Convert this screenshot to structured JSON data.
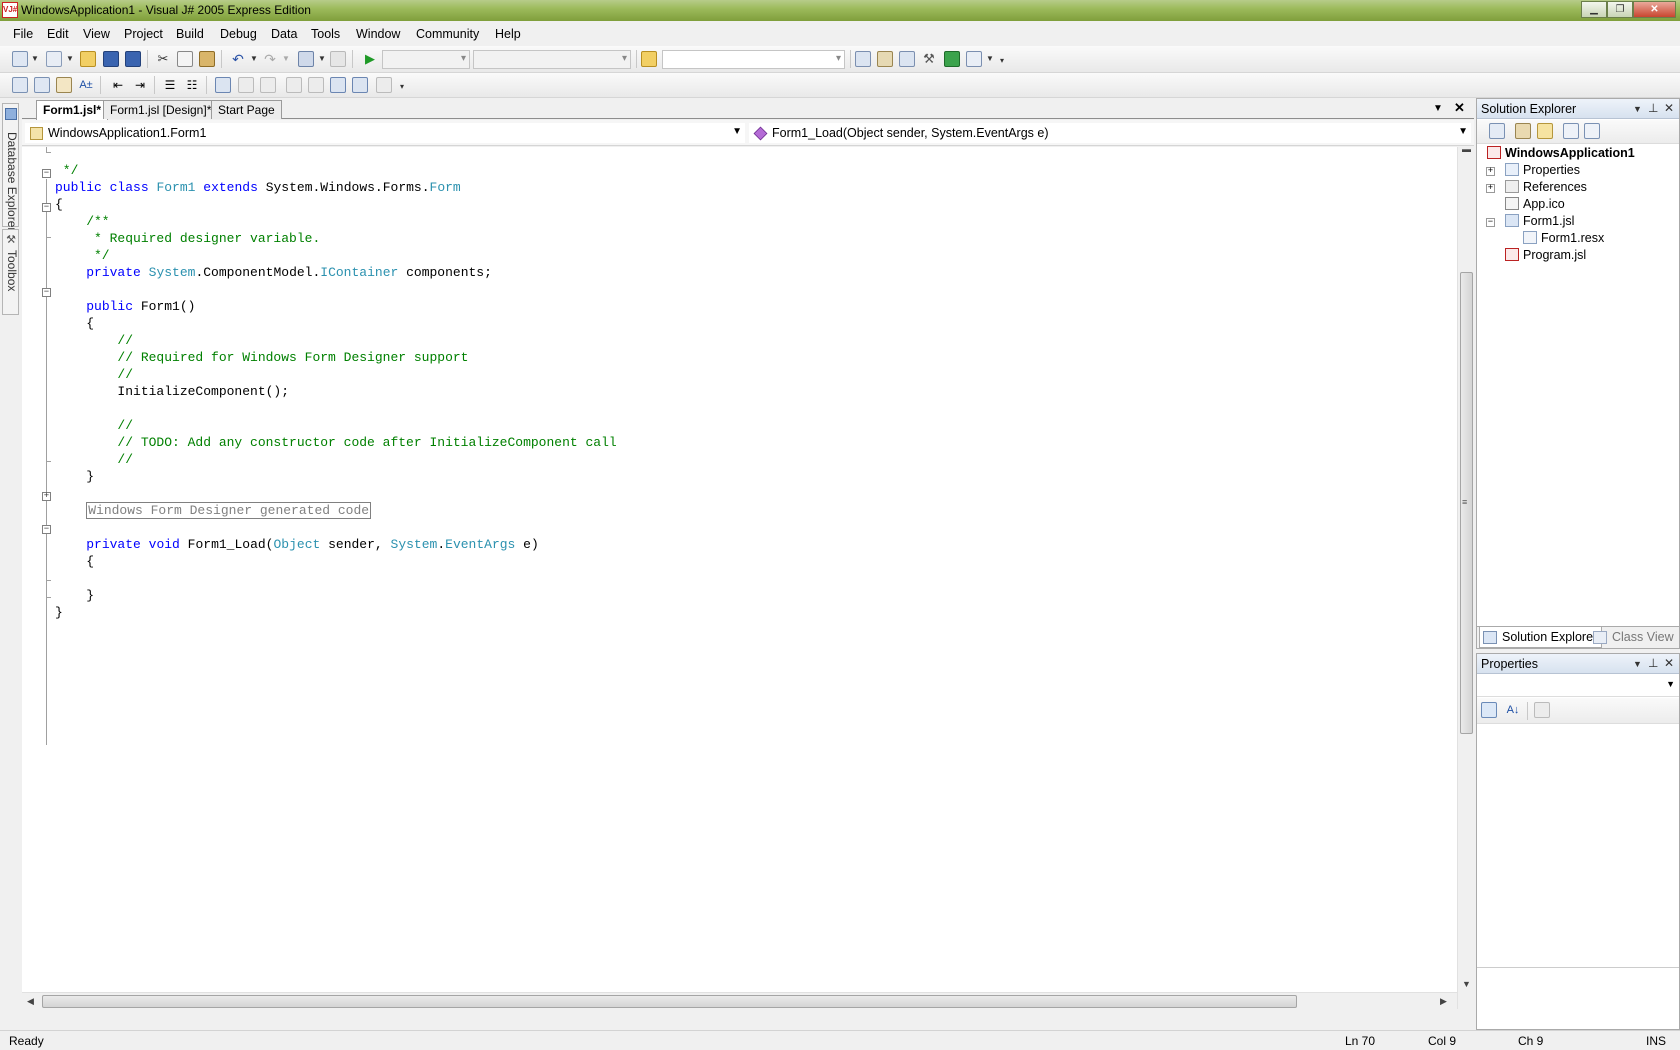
{
  "window": {
    "title": "WindowsApplication1 - Visual J# 2005 Express Edition",
    "icon_text": "VJ#"
  },
  "menu": [
    "File",
    "Edit",
    "View",
    "Project",
    "Build",
    "Debug",
    "Data",
    "Tools",
    "Window",
    "Community",
    "Help"
  ],
  "side_tabs": {
    "database_explorer": "Database Explorer",
    "toolbox": "Toolbox"
  },
  "doc_tabs": [
    "Form1.jsl*",
    "Form1.jsl [Design]*",
    "Start Page"
  ],
  "nav": {
    "class_combo": "WindowsApplication1.Form1",
    "member_combo": "Form1_Load(Object sender, System.EventArgs e)"
  },
  "code": {
    "l0": " */",
    "l1_kw1": "public",
    "l1_kw2": "class",
    "l1_type": "Form1",
    "l1_kw3": "extends",
    "l1_plain": "System.Windows.Forms.",
    "l1_type2": "Form",
    "l2": "{",
    "l3": "    /**",
    "l4": "     * Required designer variable.",
    "l5": "     */",
    "l6_kw": "private",
    "l6_ns": "System",
    "l6_mid": ".ComponentModel.",
    "l6_type": "IContainer",
    "l6_end": " components;",
    "l7": "",
    "l8_kw": "public",
    "l8_end": " Form1()",
    "l9": "    {",
    "l10": "        //",
    "l11": "        // Required for Windows Form Designer support",
    "l12": "        //",
    "l13": "        InitializeComponent();",
    "l14": "",
    "l15": "        //",
    "l16": "        // TODO: Add any constructor code after InitializeComponent call",
    "l17": "        //",
    "l18": "    }",
    "l19": "",
    "l20_region": "Windows Form Designer generated code",
    "l21": "",
    "l22_kw1": "private",
    "l22_kw2": "void",
    "l22_mid": " Form1_Load(",
    "l22_type1": "Object",
    "l22_mid2": " sender, ",
    "l22_ns": "System",
    "l22_dot": ".",
    "l22_type2": "EventArgs",
    "l22_end": " e)",
    "l23": "    {",
    "l24": "",
    "l25": "    }",
    "l26": "}"
  },
  "solution_explorer": {
    "title": "Solution Explorer",
    "project": "WindowsApplication1",
    "items": [
      "Properties",
      "References",
      "App.ico",
      "Form1.jsl",
      "Form1.resx",
      "Program.jsl"
    ]
  },
  "panel_tabs": [
    "Solution Explorer",
    "Class View"
  ],
  "properties": {
    "title": "Properties"
  },
  "status": {
    "left": "Ready",
    "ln": "Ln 70",
    "col": "Col 9",
    "ch": "Ch 9",
    "mode": "INS"
  }
}
